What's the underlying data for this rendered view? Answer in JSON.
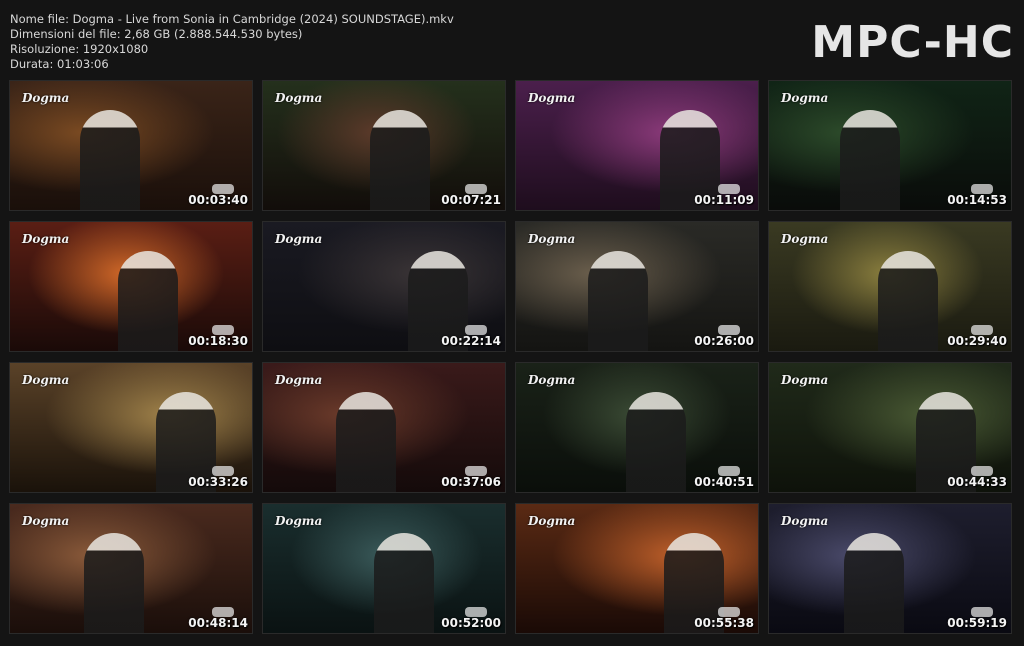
{
  "header": {
    "filename": "Nome file: Dogma - Live from Sonia in Cambridge (2024) SOUNDSTAGE).mkv",
    "filesize": "Dimensioni del file: 2,68 GB (2.888.544.530 bytes)",
    "resolution": "Risoluzione: 1920x1080",
    "duration": "Durata: 01:03:06"
  },
  "app_logo": "MPC-HC",
  "thumbnails": [
    {
      "badge": "Dogma",
      "time": "00:03:40",
      "colors": [
        "#3a2418",
        "#7a4a22",
        "#1a0f0a"
      ]
    },
    {
      "badge": "Dogma",
      "time": "00:07:21",
      "colors": [
        "#24301c",
        "#5c3a2a",
        "#120d0a"
      ]
    },
    {
      "badge": "Dogma",
      "time": "00:11:09",
      "colors": [
        "#4b1f4c",
        "#8b3a7a",
        "#1e0d1d"
      ]
    },
    {
      "badge": "Dogma",
      "time": "00:14:53",
      "colors": [
        "#102416",
        "#2c4a2a",
        "#0a0c0a"
      ]
    },
    {
      "badge": "Dogma",
      "time": "00:18:30",
      "colors": [
        "#5a1e14",
        "#d06828",
        "#1a0a08"
      ]
    },
    {
      "badge": "Dogma",
      "time": "00:22:14",
      "colors": [
        "#1a1a22",
        "#3a3436",
        "#0e0e12"
      ]
    },
    {
      "badge": "Dogma",
      "time": "00:26:00",
      "colors": [
        "#2a2a26",
        "#6a5e4c",
        "#141412"
      ]
    },
    {
      "badge": "Dogma",
      "time": "00:29:40",
      "colors": [
        "#3a3a22",
        "#8a7e3e",
        "#1a1a10"
      ]
    },
    {
      "badge": "Dogma",
      "time": "00:33:26",
      "colors": [
        "#5a4228",
        "#a0824a",
        "#1a120a"
      ]
    },
    {
      "badge": "Dogma",
      "time": "00:37:06",
      "colors": [
        "#3a1a1a",
        "#6a3a2a",
        "#140a0a"
      ]
    },
    {
      "badge": "Dogma",
      "time": "00:40:51",
      "colors": [
        "#1a2218",
        "#3a4a34",
        "#0a0e0a"
      ]
    },
    {
      "badge": "Dogma",
      "time": "00:44:33",
      "colors": [
        "#202a1a",
        "#4a5a34",
        "#0e120a"
      ]
    },
    {
      "badge": "Dogma",
      "time": "00:48:14",
      "colors": [
        "#4a2a1e",
        "#8a5a3a",
        "#1a0e0a"
      ]
    },
    {
      "badge": "Dogma",
      "time": "00:52:00",
      "colors": [
        "#1a2e2e",
        "#3a5a5a",
        "#0a1212"
      ]
    },
    {
      "badge": "Dogma",
      "time": "00:55:38",
      "colors": [
        "#5a2a14",
        "#c0602a",
        "#1a0a06"
      ]
    },
    {
      "badge": "Dogma",
      "time": "00:59:19",
      "colors": [
        "#1e1e2e",
        "#4a4a6a",
        "#0a0a12"
      ]
    }
  ]
}
